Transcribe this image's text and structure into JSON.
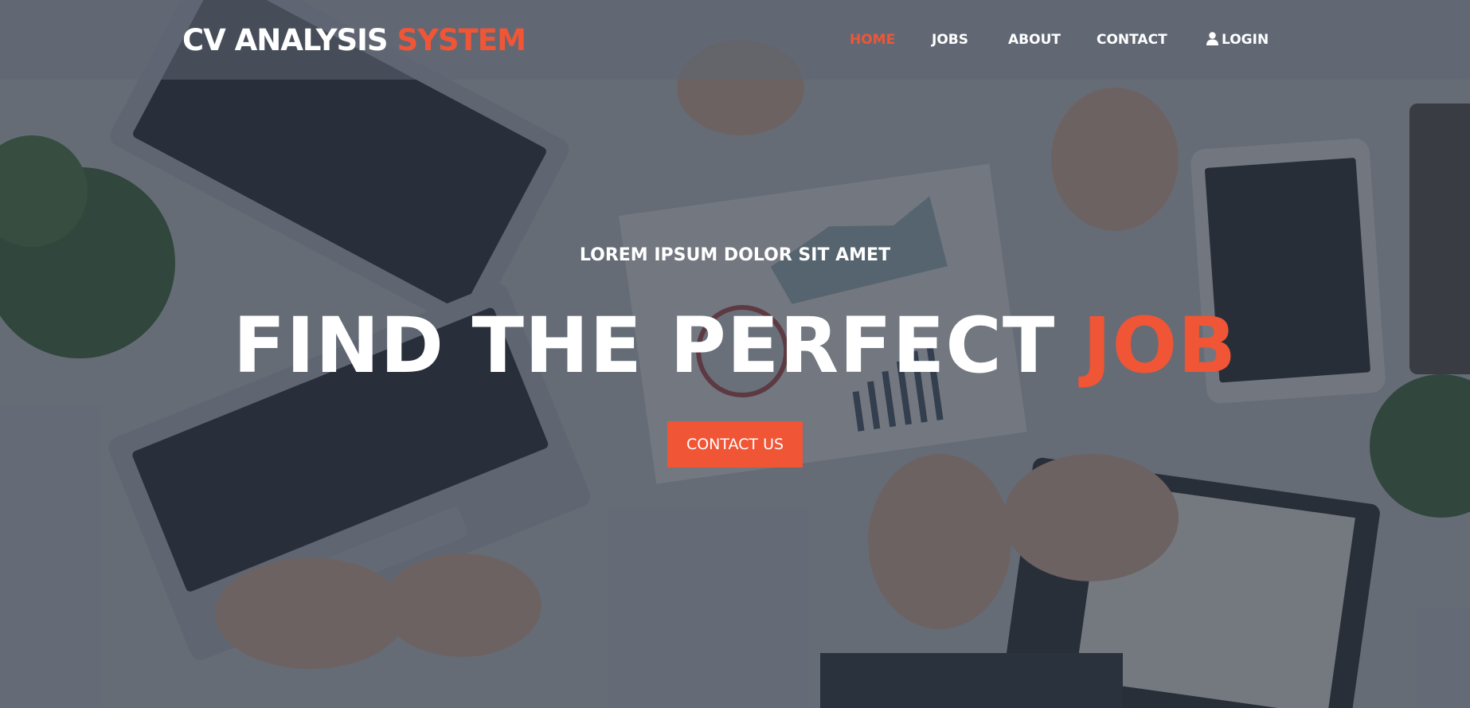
{
  "header": {
    "logo_main": "CV ANALYSIS",
    "logo_accent": "SYSTEM"
  },
  "nav": {
    "items": [
      {
        "label": "HOME",
        "active": true
      },
      {
        "label": "JOBS"
      },
      {
        "label": "ABOUT"
      },
      {
        "label": "CONTACT"
      },
      {
        "label": "LOGIN",
        "icon": "user-icon"
      }
    ]
  },
  "hero": {
    "kicker": "LOREM IPSUM DOLOR SIT AMET",
    "headline_main": "FIND THE PERFECT",
    "headline_accent": "JOB",
    "cta_label": "CONTACT US"
  },
  "colors": {
    "accent": "#f05536",
    "text": "#ffffff",
    "overlay": "#28303e"
  }
}
